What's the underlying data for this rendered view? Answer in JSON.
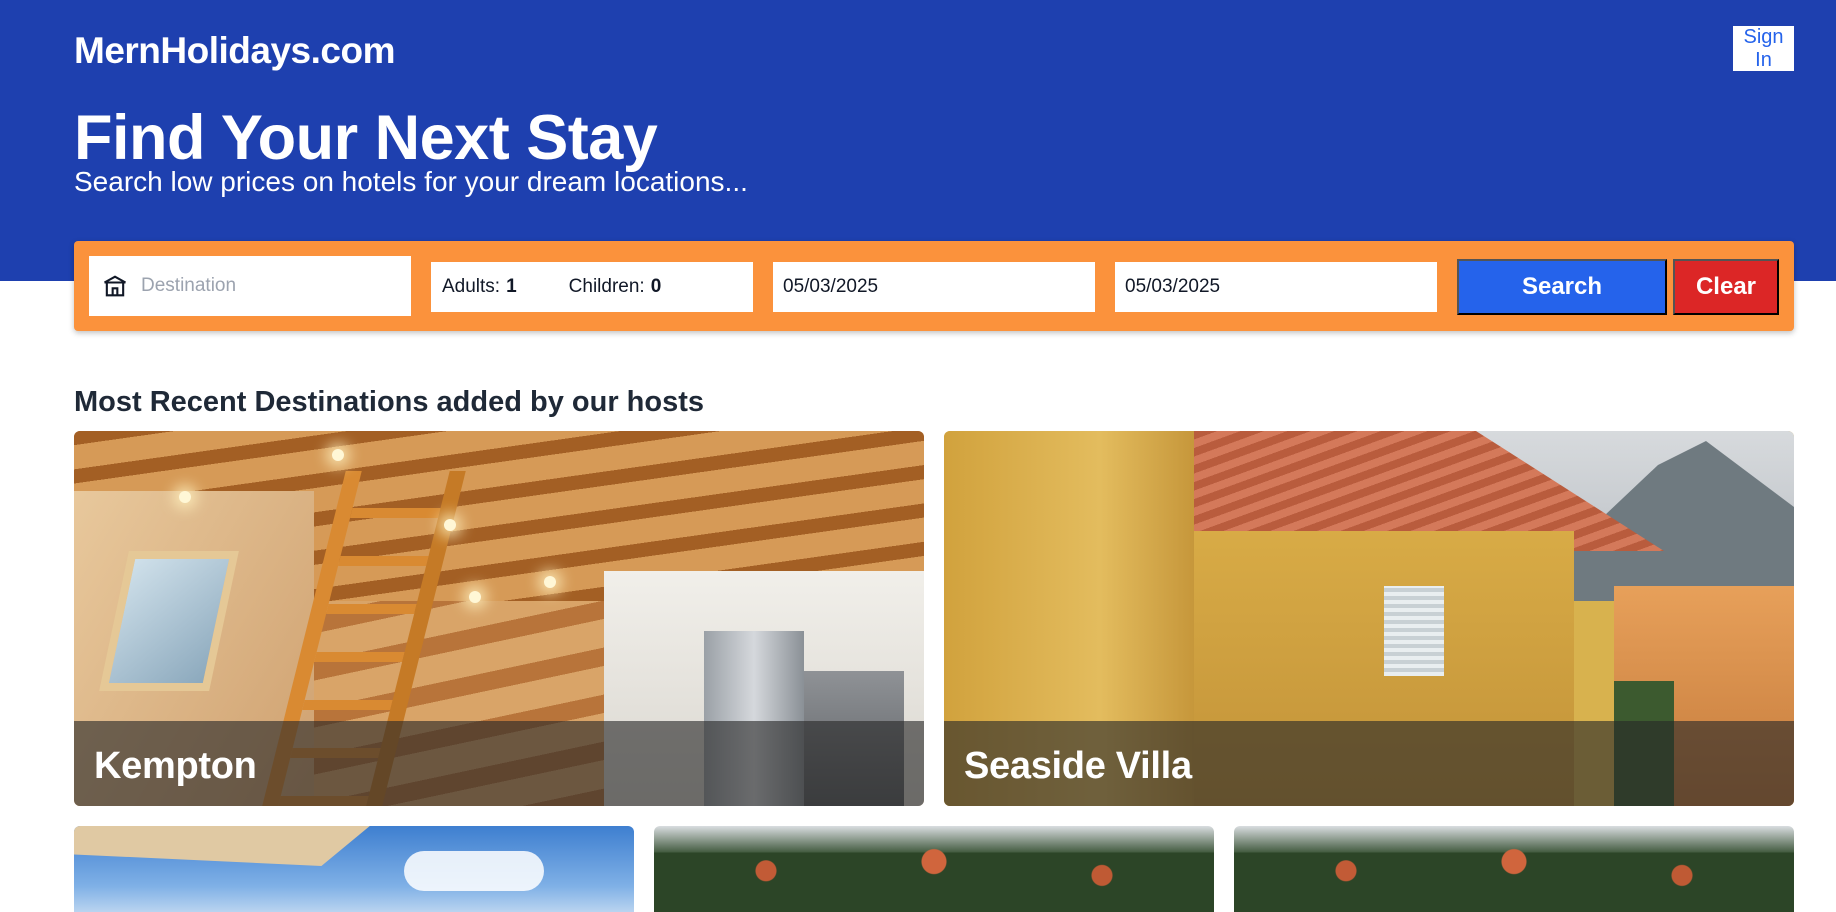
{
  "header": {
    "brand": "MernHolidays.com",
    "signin_label": "Sign In"
  },
  "hero": {
    "title": "Find Your Next Stay",
    "subtitle": "Search low prices on hotels for your dream locations..."
  },
  "search": {
    "destination_placeholder": "Destination",
    "adults_label": "Adults:",
    "adults_value": "1",
    "children_label": "Children:",
    "children_value": "0",
    "check_in": "05/03/2025",
    "check_out": "05/03/2025",
    "search_label": "Search",
    "clear_label": "Clear"
  },
  "recent": {
    "heading": "Most Recent Destinations added by our hosts",
    "cards": [
      {
        "name": "Kempton"
      },
      {
        "name": "Seaside Villa"
      }
    ]
  },
  "colors": {
    "hero_bg": "#1e40af",
    "searchbar_bg": "#fb923c",
    "search_button": "#2563eb",
    "clear_button": "#dc2626"
  },
  "icons": {
    "destination": "building-icon"
  }
}
